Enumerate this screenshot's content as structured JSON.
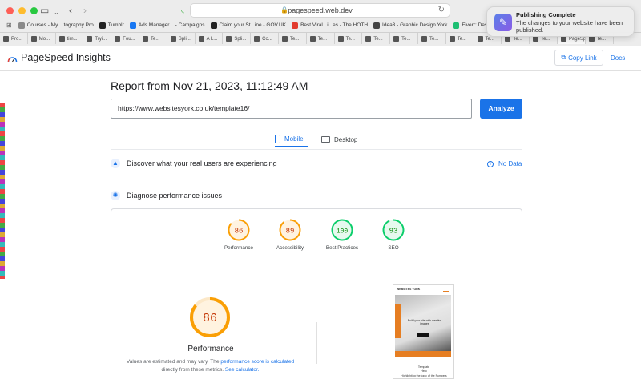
{
  "browser": {
    "url": "pagespeed.web.dev",
    "bookmarks": [
      {
        "label": "Courses - My ...tography Pro",
        "color": "#8a8a8a"
      },
      {
        "label": "Tumblr",
        "color": "#222222"
      },
      {
        "label": "Ads Manager ...- Campaigns",
        "color": "#1877f2"
      },
      {
        "label": "Claim your St...ine - GOV.UK",
        "color": "#222222"
      },
      {
        "label": "Best Viral Li...es - The HOTH",
        "color": "#e23b2e"
      },
      {
        "label": "Idea3 - Graphic Design York",
        "color": "#444444"
      },
      {
        "label": "Fiverr: Desi",
        "color": "#1dbf73"
      }
    ],
    "tabs": [
      "Pro...",
      "Mo...",
      "tim...",
      "Tryi...",
      "Fou...",
      "Te...",
      "Spli...",
      "A L...",
      "Spli...",
      "Co...",
      "Te...",
      "Te...",
      "Te...",
      "Te...",
      "Te...",
      "Te...",
      "Te...",
      "Te...",
      "Te...",
      "Te...",
      "PageSp...",
      "Te..."
    ],
    "active_tab_index": 20
  },
  "notification": {
    "title": "Publishing Complete",
    "body": "The changes to your website have been published."
  },
  "header": {
    "brand": "PageSpeed Insights",
    "copy_link": "Copy Link",
    "docs": "Docs"
  },
  "report": {
    "title": "Report from Nov 21, 2023, 11:12:49 AM",
    "url_value": "https://www.websitesyork.co.uk/template16/",
    "analyze_label": "Analyze"
  },
  "device_tabs": {
    "mobile": "Mobile",
    "desktop": "Desktop",
    "selected": "mobile"
  },
  "sections": {
    "discover": "Discover what your real users are experiencing",
    "no_data": "No Data",
    "diagnose": "Diagnose performance issues"
  },
  "scores": [
    {
      "label": "Performance",
      "value": 86,
      "color": "#fa9f05"
    },
    {
      "label": "Accessibility",
      "value": 89,
      "color": "#fa9f05"
    },
    {
      "label": "Best Practices",
      "value": 100,
      "color": "#0cce6b"
    },
    {
      "label": "SEO",
      "value": 93,
      "color": "#0cce6b"
    }
  ],
  "performance_detail": {
    "value": 86,
    "label": "Performance",
    "note_prefix": "Values are estimated and may vary. The",
    "note_link1": "performance score is calculated",
    "note_mid": "directly from these metrics.",
    "note_link2": "See calculator."
  },
  "screenshot_preview": {
    "site_name": "WEBSITES YORK",
    "hero_text": "Build your site with creative images",
    "caption": "Template",
    "caption2": "Hero",
    "footer_text": "Highlighting the topic of the Pumpers"
  }
}
